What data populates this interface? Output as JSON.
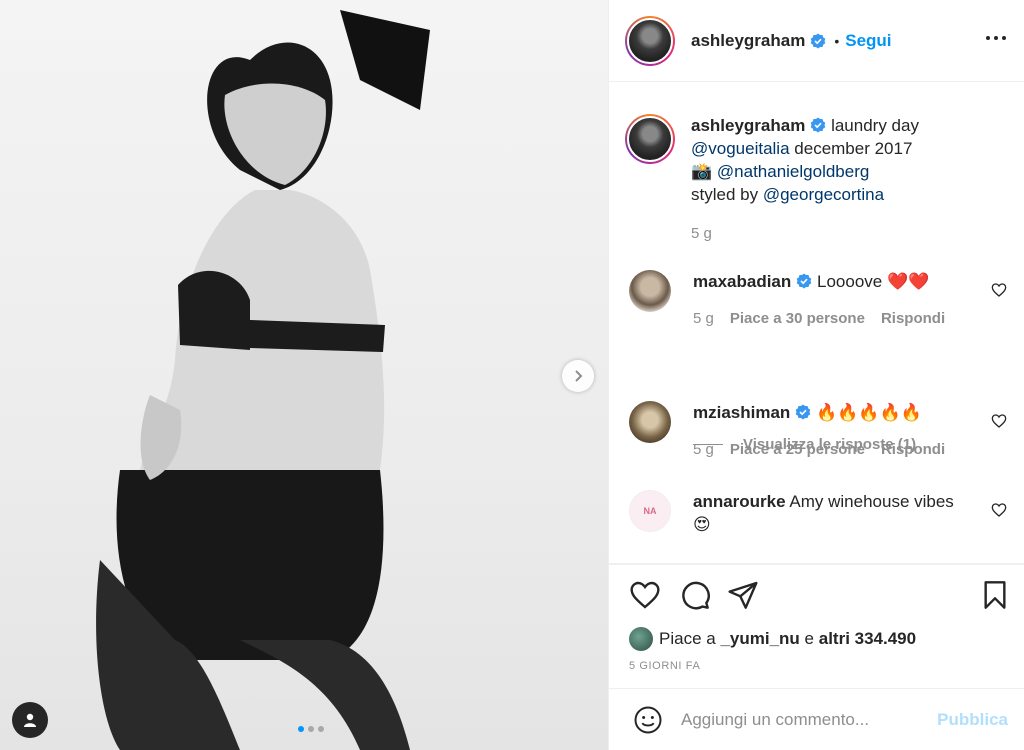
{
  "post": {
    "author": "ashleygraham",
    "follow_label": "Segui",
    "bullet": "•"
  },
  "caption": {
    "author": "ashleygraham",
    "line1": "laundry day",
    "mention1": "@vogueitalia",
    "line2": "december 2017",
    "camera_emoji": "📸",
    "mention2": "@nathanielgoldberg",
    "styled_prefix": "styled by",
    "mention3": "@georgecortina",
    "time": "5 g"
  },
  "comments": [
    {
      "user": "maxabadian",
      "text": "Loooove ❤️❤️",
      "time": "5 g",
      "likes": "Piace a 30 persone",
      "reply": "Rispondi",
      "verified": true
    },
    {
      "user": "mziashiman",
      "text": "🔥🔥🔥🔥🔥",
      "time": "5 g",
      "likes": "Piace a 25 persone",
      "reply": "Rispondi",
      "verified": true
    },
    {
      "user": "annarourke",
      "text": "Amy winehouse vibes",
      "text2": "😍",
      "verified": false
    }
  ],
  "view_replies": "Visualizza le risposte (1)",
  "likes": {
    "prefix": "Piace a",
    "user": "_yumi_nu",
    "middle": "e",
    "others": "altri 334.490"
  },
  "date": "5 GIORNI FA",
  "add_comment": {
    "placeholder": "Aggiungi un commento...",
    "publish": "Pubblica"
  },
  "colors": {
    "link": "#0095f6",
    "mention": "#00376b",
    "muted": "#8e8e8e"
  },
  "icons": [
    "user-tag-icon",
    "chevron-right-icon",
    "more-icon",
    "verified-icon",
    "heart-icon",
    "comment-icon",
    "share-icon",
    "bookmark-icon",
    "emoji-icon"
  ]
}
